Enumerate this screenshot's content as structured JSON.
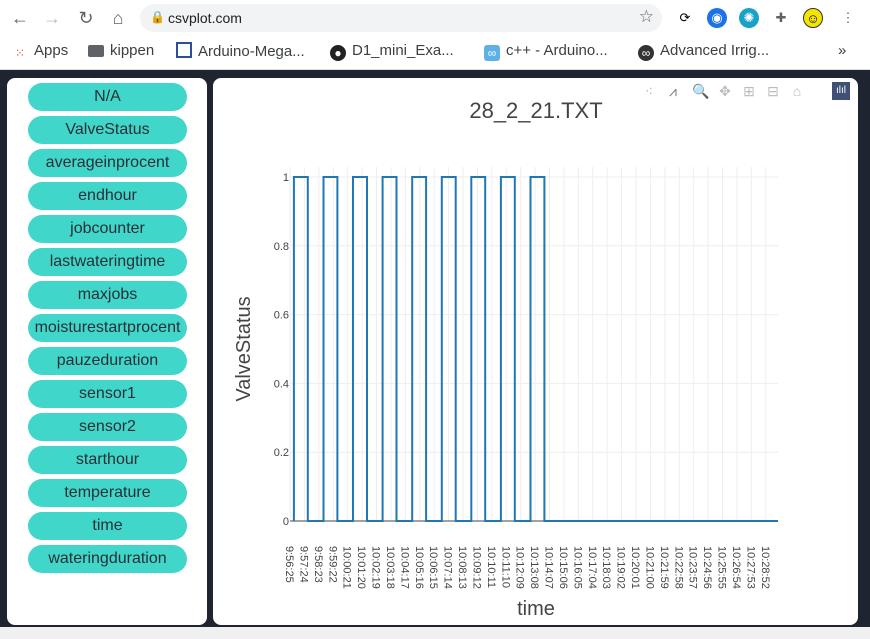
{
  "browser": {
    "url": "csvplot.com",
    "bookmarks": [
      "Apps",
      "kippen",
      "Arduino-Mega...",
      "D1_mini_Exa...",
      "c++ - Arduino...",
      "Advanced Irrig..."
    ],
    "more_label": "»"
  },
  "sidebar": {
    "items": [
      "N/A",
      "ValveStatus",
      "averageinprocent",
      "endhour",
      "jobcounter",
      "lastwateringtime",
      "maxjobs",
      "moisturestartprocent",
      "pauzeduration",
      "sensor1",
      "sensor2",
      "starthour",
      "temperature",
      "time",
      "wateringduration"
    ],
    "button_color": "#40d6c9"
  },
  "modebar": {
    "icons": [
      "compare-data-icon",
      "closest-data-icon",
      "zoom-icon",
      "pan-icon",
      "zoom-in-icon",
      "zoom-out-icon",
      "reset-axes-icon",
      "plotly-logo-icon"
    ]
  },
  "chart_data": {
    "type": "line",
    "title": "28_2_21.TXT",
    "xlabel": "time",
    "ylabel": "ValveStatus",
    "line_color": "#1f77b4",
    "grid": true,
    "ylim": [
      0,
      1
    ],
    "xlim": [
      "9:56:25",
      "10:29:42"
    ],
    "yticks": [
      "0",
      "0.2",
      "0.4",
      "0.6",
      "0.8",
      "1"
    ],
    "xticks": [
      "9:56:25",
      "9:57:24",
      "9:58:23",
      "9:59:22",
      "10:00:21",
      "10:01:20",
      "10:02:19",
      "10:03:18",
      "10:04:17",
      "10:05:16",
      "10:06:15",
      "10:07:14",
      "10:08:13",
      "10:09:12",
      "10:10:11",
      "10:11:10",
      "10:12:09",
      "10:13:08",
      "10:14:07",
      "10:15:06",
      "10:16:05",
      "10:17:04",
      "10:18:03",
      "10:19:02",
      "10:20:01",
      "10:21:00",
      "10:21:59",
      "10:22:58",
      "10:23:57",
      "10:24:56",
      "10:25:55",
      "10:26:54",
      "10:27:53",
      "10:28:52"
    ],
    "series": [
      {
        "x": [
          "9:56:41",
          "9:56:41",
          "9:57:38",
          "9:57:38",
          "9:58:42",
          "9:58:42",
          "9:59:39",
          "9:59:39",
          "10:00:43",
          "10:00:43",
          "10:01:40",
          "10:01:40",
          "10:02:44",
          "10:02:44",
          "10:03:41",
          "10:03:41",
          "10:04:45",
          "10:04:45",
          "10:05:42",
          "10:05:42",
          "10:06:46",
          "10:06:46",
          "10:07:43",
          "10:07:43",
          "10:08:47",
          "10:08:47",
          "10:09:44",
          "10:09:44",
          "10:10:48",
          "10:10:48",
          "10:11:45",
          "10:11:45",
          "10:12:49",
          "10:12:49",
          "10:13:46",
          "10:13:46",
          "10:29:42"
        ],
        "y": [
          0,
          1,
          1,
          0,
          0,
          1,
          1,
          0,
          0,
          1,
          1,
          0,
          0,
          1,
          1,
          0,
          0,
          1,
          1,
          0,
          0,
          1,
          1,
          0,
          0,
          1,
          1,
          0,
          0,
          1,
          1,
          0,
          0,
          1,
          1,
          0,
          0
        ]
      }
    ]
  }
}
